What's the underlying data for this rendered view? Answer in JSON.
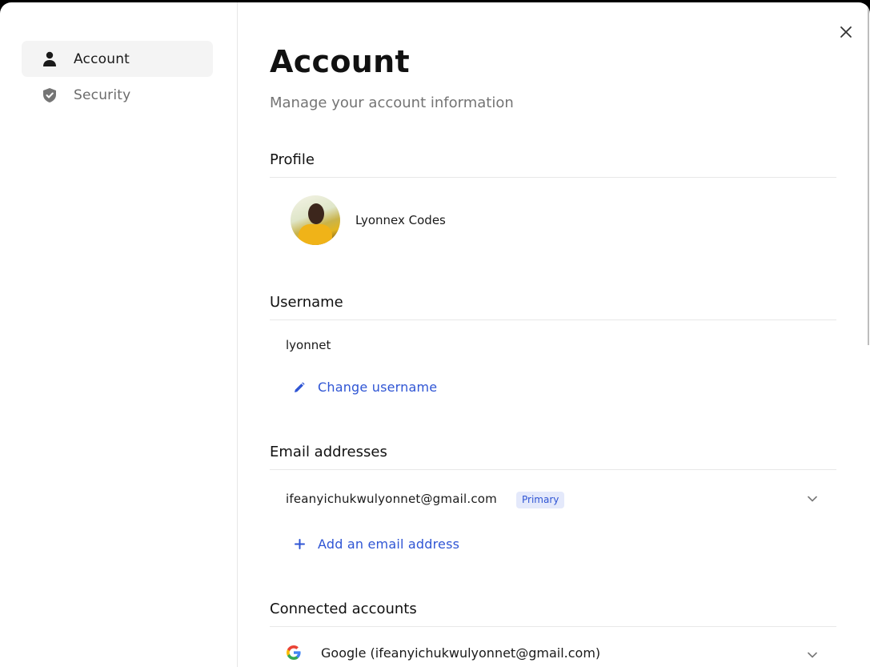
{
  "sidebar": {
    "items": [
      {
        "label": "Account",
        "icon": "person-icon",
        "active": true
      },
      {
        "label": "Security",
        "icon": "shield-check-icon",
        "active": false
      }
    ]
  },
  "header": {
    "title": "Account",
    "subtitle": "Manage your account information"
  },
  "profile": {
    "section_title": "Profile",
    "name": "Lyonnex Codes"
  },
  "username": {
    "section_title": "Username",
    "value": "lyonnet",
    "change_label": "Change username"
  },
  "emails": {
    "section_title": "Email addresses",
    "items": [
      {
        "address": "ifeanyichukwulyonnet@gmail.com",
        "badge": "Primary"
      }
    ],
    "add_label": "Add an email address"
  },
  "connected": {
    "section_title": "Connected accounts",
    "items": [
      {
        "provider_label": "Google (ifeanyichukwulyonnet@gmail.com)"
      }
    ]
  },
  "colors": {
    "accent": "#2f55d4",
    "badge_bg": "#e4e9fb",
    "active_nav_bg": "#f4f4f4"
  }
}
